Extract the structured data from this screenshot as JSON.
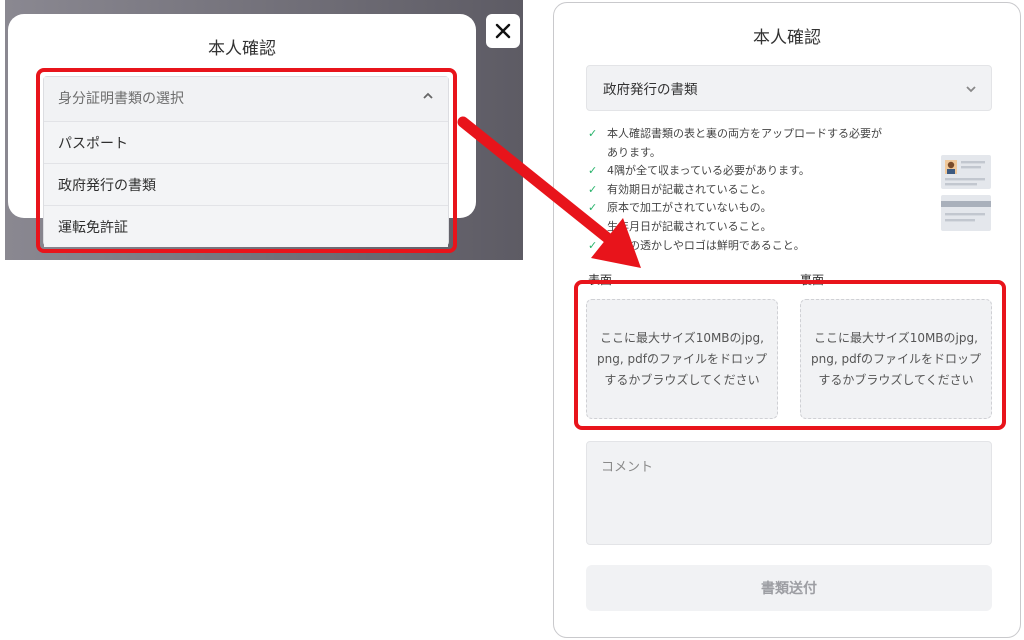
{
  "left": {
    "modal_title": "本人確認",
    "close_icon": "close-icon",
    "dropdown": {
      "placeholder": "身分証明書類の選択",
      "options": [
        "パスポート",
        "政府発行の書類",
        "運転免許証"
      ]
    }
  },
  "right": {
    "modal_title": "本人確認",
    "selected_document": "政府発行の書類",
    "requirements": [
      "本人確認書類の表と裏の両方をアップロードする必要が",
      "あります。",
      "4隅が全て収まっている必要があります。",
      "有効期日が記載されていること。",
      "原本で加工がされていないもの。",
      "生年月日が記載されていること。",
      "写真の透かしやロゴは鮮明であること。"
    ],
    "front_label": "表面",
    "back_label": "裏面",
    "dropzone_text": "ここに最大サイズ10MBのjpg, png, pdfのファイルをドロップするかブラウズしてください",
    "comment_placeholder": "コメント",
    "submit_label": "書類送付"
  },
  "colors": {
    "highlight": "#e8141b",
    "check": "#27b36b",
    "field_bg": "#f1f2f4"
  }
}
